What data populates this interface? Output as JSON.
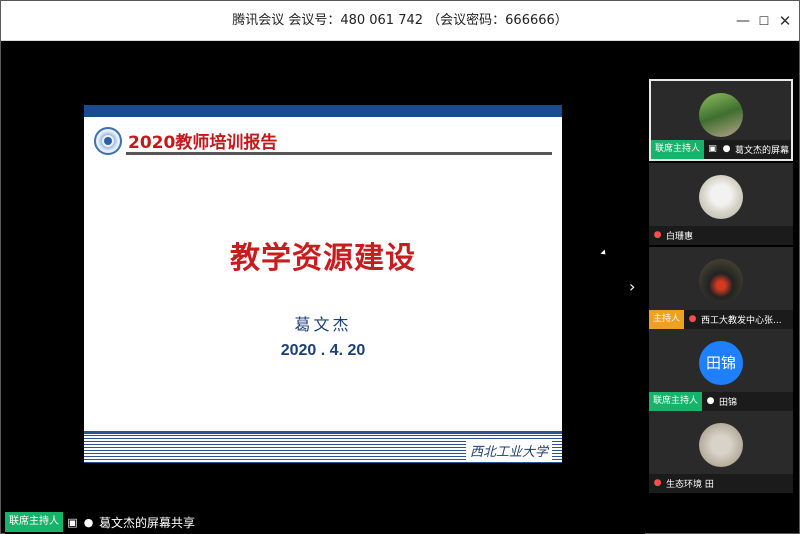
{
  "window": {
    "title": "腾讯会议 会议号：480 061 742 （会议密码：666666）"
  },
  "controls": {
    "minimize": "—",
    "maximize": "☐",
    "close": "✕"
  },
  "slide": {
    "heading": "2020教师培训报告",
    "main_title": "教学资源建设",
    "author": "葛文杰",
    "date": "2020 . 4. 20",
    "signature": "西北工业大学"
  },
  "expand_arrow": "›",
  "participants": [
    {
      "badge": "联席主持人",
      "badge_color": "#18b36b",
      "name": "葛文杰的屏幕",
      "sharing": true,
      "muted": false,
      "avatar_text": ""
    },
    {
      "badge": "",
      "badge_color": "",
      "name": "白珊惠",
      "sharing": false,
      "muted": true,
      "avatar_text": ""
    },
    {
      "badge": "主持人",
      "badge_color": "#f0a020",
      "name": "西工大教发中心张...",
      "sharing": false,
      "muted": true,
      "avatar_text": ""
    },
    {
      "badge": "联席主持人",
      "badge_color": "#18b36b",
      "name": "田锦",
      "sharing": false,
      "muted": false,
      "avatar_text": "田锦"
    },
    {
      "badge": "",
      "badge_color": "",
      "name": "生态环境 田",
      "sharing": false,
      "muted": true,
      "avatar_text": ""
    }
  ],
  "status": {
    "badge": "联席主持人",
    "label": "葛文杰的屏幕共享"
  },
  "icons": {
    "share": "share-screen-icon",
    "mic": "microphone-icon",
    "mic_muted": "microphone-muted-icon"
  }
}
